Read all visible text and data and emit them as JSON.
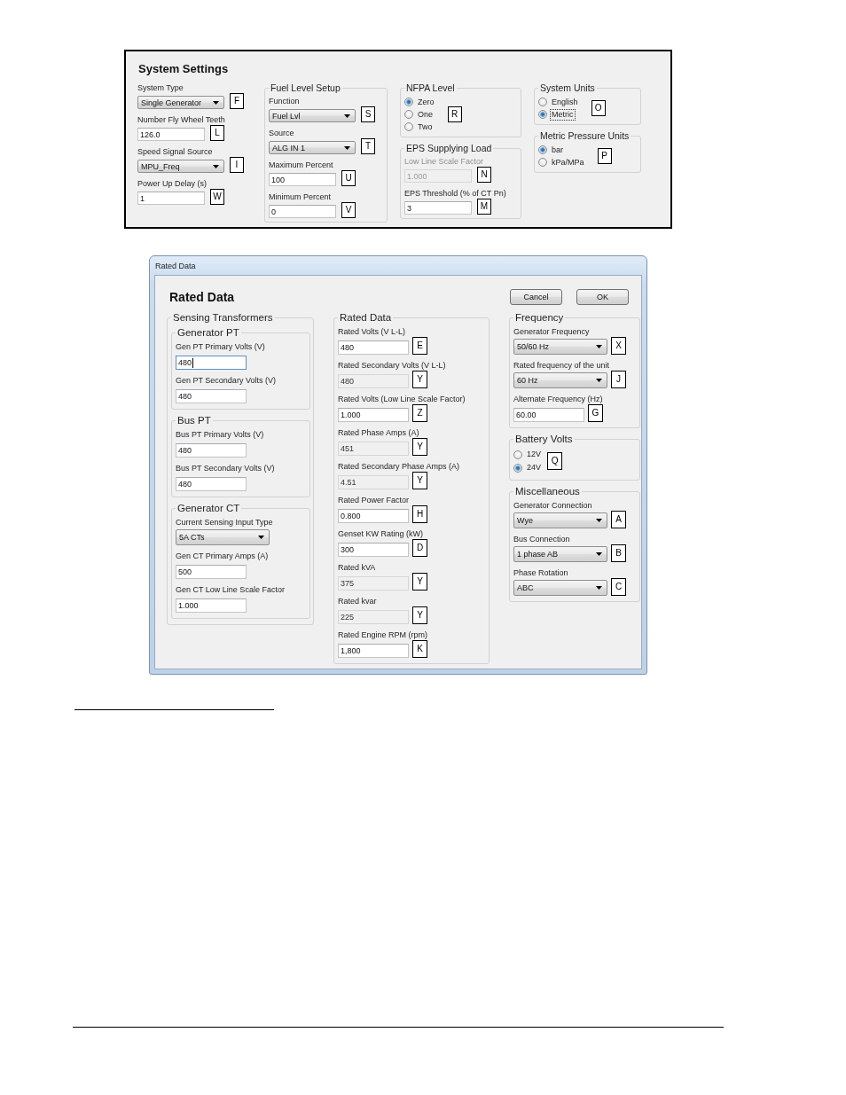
{
  "system_settings": {
    "title": "System Settings",
    "columns": [
      {
        "groups": [
          {
            "fields": [
              {
                "kind": "dropdown",
                "label": "System Type",
                "value": "Single Generator",
                "tag": "F",
                "disabled": false
              },
              {
                "kind": "text",
                "label": "Number Fly Wheel Teeth",
                "value": "126.0",
                "tag": "L",
                "disabled": false,
                "readonly": false,
                "focused": false
              },
              {
                "kind": "dropdown",
                "label": "Speed Signal Source",
                "value": "MPU_Freq",
                "tag": "I",
                "disabled": false
              },
              {
                "kind": "text",
                "label": "Power Up Delay (s)",
                "value": "1",
                "tag": "W",
                "disabled": false,
                "readonly": false,
                "focused": false
              }
            ]
          }
        ]
      },
      {
        "groups": [
          {
            "title": "Fuel Level Setup",
            "fields": [
              {
                "kind": "dropdown",
                "label": "Function",
                "value": "Fuel Lvl",
                "tag": "S",
                "disabled": false
              },
              {
                "kind": "dropdown",
                "label": "Source",
                "value": "ALG IN 1",
                "tag": "T",
                "disabled": false
              },
              {
                "kind": "text",
                "label": "Maximum Percent",
                "value": "100",
                "tag": "U",
                "disabled": false,
                "readonly": false,
                "focused": false
              },
              {
                "kind": "text",
                "label": "Minimum Percent",
                "value": "0",
                "tag": "V",
                "disabled": false,
                "readonly": false,
                "focused": false
              }
            ]
          }
        ]
      },
      {
        "groups": [
          {
            "title": "NFPA Level",
            "fields": [
              {
                "kind": "radio",
                "tag": "R",
                "options": [
                  {
                    "label": "Zero",
                    "selected": true,
                    "focused": false
                  },
                  {
                    "label": "One",
                    "selected": false,
                    "focused": false
                  },
                  {
                    "label": "Two",
                    "selected": false,
                    "focused": false
                  }
                ]
              }
            ]
          },
          {
            "title": "EPS Supplying Load",
            "fields": [
              {
                "kind": "text",
                "label": "Low Line Scale Factor",
                "value": "1.000",
                "tag": "N",
                "disabled": true,
                "readonly": false,
                "focused": false
              },
              {
                "kind": "text",
                "label": "EPS Threshold (% of CT Pn)",
                "value": "3",
                "tag": "M",
                "disabled": false,
                "readonly": false,
                "focused": false
              }
            ]
          }
        ]
      },
      {
        "groups": [
          {
            "title": "System Units",
            "fields": [
              {
                "kind": "radio",
                "tag": "O",
                "options": [
                  {
                    "label": "English",
                    "selected": false,
                    "focused": false
                  },
                  {
                    "label": "Metric",
                    "selected": true,
                    "focused": true
                  }
                ]
              }
            ]
          },
          {
            "title": "Metric Pressure Units",
            "fields": [
              {
                "kind": "radio",
                "tag": "P",
                "options": [
                  {
                    "label": "bar",
                    "selected": true,
                    "focused": false
                  },
                  {
                    "label": "kPa/MPa",
                    "selected": false,
                    "focused": false
                  }
                ]
              }
            ]
          }
        ]
      }
    ]
  },
  "rated_data_dialog": {
    "window_title": "Rated Data",
    "heading": "Rated Data",
    "buttons": [
      "Cancel",
      "OK"
    ],
    "columns": [
      {
        "groups": [
          {
            "title": "Sensing Transformers",
            "groups": [
              {
                "title": "Generator PT",
                "fields": [
                  {
                    "kind": "text",
                    "label": "Gen PT Primary Volts (V)",
                    "value": "480",
                    "disabled": false,
                    "readonly": false,
                    "focused": true
                  },
                  {
                    "kind": "text",
                    "label": "Gen PT Secondary Volts (V)",
                    "value": "480",
                    "disabled": false,
                    "readonly": false,
                    "focused": false
                  }
                ]
              },
              {
                "title": "Bus PT",
                "fields": [
                  {
                    "kind": "text",
                    "label": "Bus PT Primary Volts (V)",
                    "value": "480",
                    "disabled": false,
                    "readonly": false,
                    "focused": false
                  },
                  {
                    "kind": "text",
                    "label": "Bus PT Secondary Volts (V)",
                    "value": "480",
                    "disabled": false,
                    "readonly": false,
                    "focused": false
                  }
                ]
              },
              {
                "title": "Generator CT",
                "fields": [
                  {
                    "kind": "dropdown",
                    "label": "Current Sensing Input Type",
                    "value": "5A CTs",
                    "disabled": false
                  },
                  {
                    "kind": "text",
                    "label": "Gen CT Primary Amps (A)",
                    "value": "500",
                    "disabled": false,
                    "readonly": false,
                    "focused": false
                  },
                  {
                    "kind": "text",
                    "label": "Gen CT Low Line Scale Factor",
                    "value": "1.000",
                    "disabled": false,
                    "readonly": false,
                    "focused": false
                  }
                ]
              }
            ]
          }
        ]
      },
      {
        "groups": [
          {
            "title": "Rated Data",
            "fields": [
              {
                "kind": "text",
                "label": "Rated Volts (V L-L)",
                "value": "480",
                "tag": "E",
                "disabled": false,
                "readonly": false,
                "focused": false
              },
              {
                "kind": "text",
                "label": "Rated Secondary Volts (V L-L)",
                "value": "480",
                "tag": "Y",
                "disabled": false,
                "readonly": true,
                "focused": false
              },
              {
                "kind": "text",
                "label": "Rated Volts (Low Line Scale Factor)",
                "value": "1.000",
                "tag": "Z",
                "disabled": false,
                "readonly": false,
                "focused": false
              },
              {
                "kind": "text",
                "label": "Rated Phase Amps (A)",
                "value": "451",
                "tag": "Y",
                "disabled": false,
                "readonly": true,
                "focused": false
              },
              {
                "kind": "text",
                "label": "Rated Secondary Phase Amps (A)",
                "value": "4.51",
                "tag": "Y",
                "disabled": false,
                "readonly": true,
                "focused": false
              },
              {
                "kind": "text",
                "label": "Rated Power Factor",
                "value": "0.800",
                "tag": "H",
                "disabled": false,
                "readonly": false,
                "focused": false
              },
              {
                "kind": "text",
                "label": "Genset KW Rating (kW)",
                "value": "300",
                "tag": "D",
                "disabled": false,
                "readonly": false,
                "focused": false
              },
              {
                "kind": "text",
                "label": "Rated kVA",
                "value": "375",
                "tag": "Y",
                "disabled": false,
                "readonly": true,
                "focused": false
              },
              {
                "kind": "text",
                "label": "Rated kvar",
                "value": "225",
                "tag": "Y",
                "disabled": false,
                "readonly": true,
                "focused": false
              },
              {
                "kind": "text",
                "label": "Rated Engine RPM (rpm)",
                "value": "1,800",
                "tag": "K",
                "disabled": false,
                "readonly": false,
                "focused": false
              }
            ]
          }
        ]
      },
      {
        "groups": [
          {
            "title": "Frequency",
            "fields": [
              {
                "kind": "dropdown",
                "label": "Generator Frequency",
                "value": "50/60 Hz",
                "tag": "X",
                "disabled": false
              },
              {
                "kind": "dropdown",
                "label": "Rated frequency of the unit",
                "value": "60 Hz",
                "tag": "J",
                "disabled": false
              },
              {
                "kind": "text",
                "label": "Alternate Frequency (Hz)",
                "value": "60.00",
                "tag": "G",
                "disabled": false,
                "readonly": false,
                "focused": false
              }
            ]
          },
          {
            "title": "Battery Volts",
            "fields": [
              {
                "kind": "radio",
                "tag": "Q",
                "options": [
                  {
                    "label": "12V",
                    "selected": false,
                    "focused": false
                  },
                  {
                    "label": "24V",
                    "selected": true,
                    "focused": false
                  }
                ]
              }
            ]
          },
          {
            "title": "Miscellaneous",
            "fields": [
              {
                "kind": "dropdown",
                "label": "Generator Connection",
                "value": "Wye",
                "tag": "A",
                "disabled": false
              },
              {
                "kind": "dropdown",
                "label": "Bus Connection",
                "value": "1 phase AB",
                "tag": "B",
                "disabled": false
              },
              {
                "kind": "dropdown",
                "label": "Phase Rotation",
                "value": "ABC",
                "tag": "C",
                "disabled": false
              }
            ]
          }
        ]
      }
    ]
  }
}
